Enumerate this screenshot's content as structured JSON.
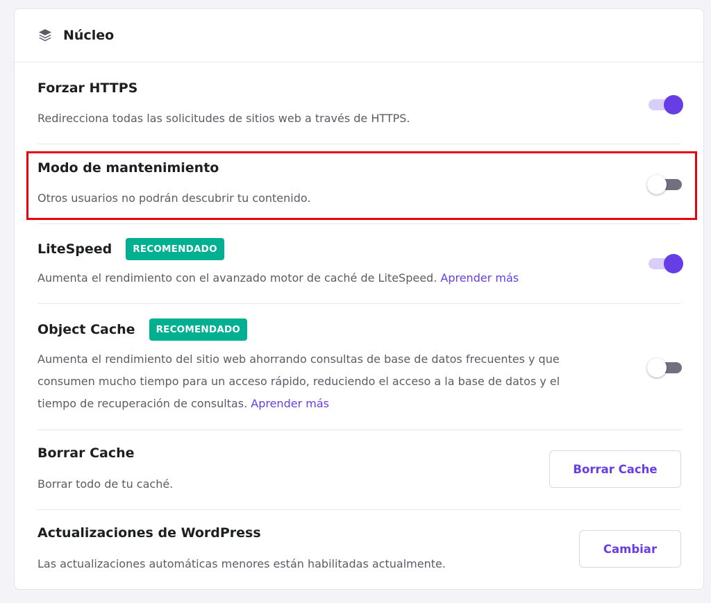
{
  "header": {
    "title": "Núcleo",
    "icon": "layers-icon"
  },
  "settings": [
    {
      "title": "Forzar HTTPS",
      "description": "Redirecciona todas las solicitudes de sitios web a través de HTTPS.",
      "control": "toggle",
      "enabled": true
    },
    {
      "title": "Modo de mantenimiento",
      "description": "Otros usuarios no podrán descubrir tu contenido.",
      "control": "toggle",
      "enabled": false,
      "highlighted": true
    },
    {
      "title": "LiteSpeed",
      "badge": "RECOMENDADO",
      "description": "Aumenta el rendimiento con el avanzado motor de caché de LiteSpeed.",
      "link": "Aprender más",
      "control": "toggle",
      "enabled": true
    },
    {
      "title": "Object Cache",
      "badge": "RECOMENDADO",
      "description_lines": [
        "Aumenta el rendimiento del sitio web ahorrando consultas de base de datos frecuentes y que",
        "consumen mucho tiempo para un acceso rápido, reduciendo el acceso a la base de datos y el",
        "tiempo de recuperación de consultas."
      ],
      "link": "Aprender más",
      "control": "toggle",
      "enabled": false
    },
    {
      "title": "Borrar Cache",
      "description": "Borrar todo de tu caché.",
      "control": "button",
      "button_label": "Borrar Cache"
    },
    {
      "title": "Actualizaciones de WordPress",
      "description": "Las actualizaciones automáticas menores están habilitadas actualmente.",
      "control": "button",
      "button_label": "Cambiar"
    }
  ],
  "colors": {
    "accent": "#673de6",
    "badge": "#00b090",
    "highlight_border": "#e8000f",
    "toggle_off_track": "#70707e",
    "toggle_on_track": "#d9cef9"
  }
}
